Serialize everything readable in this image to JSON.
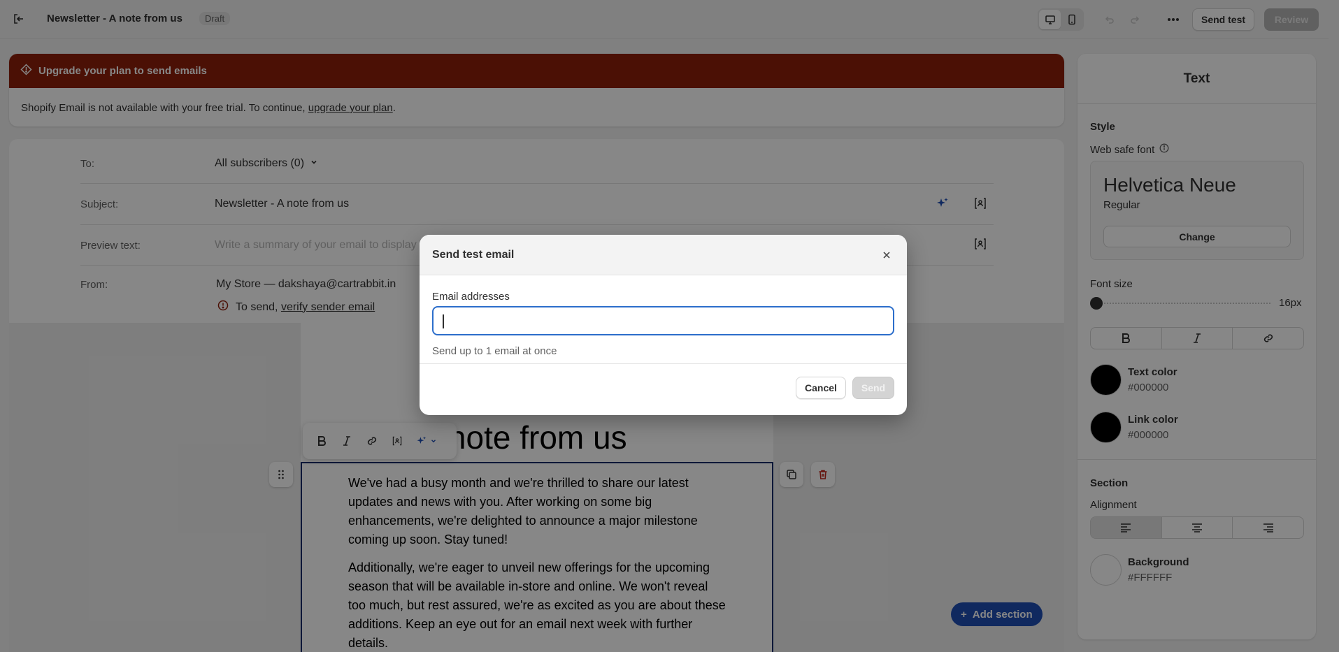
{
  "topbar": {
    "title": "Newsletter - A note from us",
    "status": "Draft",
    "send_test_label": "Send test",
    "review_label": "Review"
  },
  "banner": {
    "heading": "Upgrade your plan to send emails",
    "body_prefix": "Shopify Email is not available with your free trial. To continue, ",
    "link_text": "upgrade your plan",
    "body_suffix": "."
  },
  "fields": {
    "to_label": "To:",
    "to_value": "All subscribers (0)",
    "subject_label": "Subject:",
    "subject_value": "Newsletter - A note from us",
    "preview_label": "Preview text:",
    "preview_placeholder": "Write a summary of your email to display after the subject line",
    "from_label": "From:",
    "from_value": "My Store — dakshaya@cartrabbit.in",
    "verify_prefix": "To send, ",
    "verify_link": "verify sender email"
  },
  "email": {
    "heading": "A note from us",
    "paragraphs": [
      "We've had a busy month and we're thrilled to share our latest updates and news with you. After working on some big enhancements, we're delighted to announce a major milestone coming up soon. Stay tuned!",
      "Additionally, we're eager to unveil new offerings for the upcoming season that will be available in-store and online. We won't reveal too much, but rest assured, we're as excited as you are about these additions. Keep an eye out for an email next week with further details."
    ],
    "add_section_label": "Add section"
  },
  "panel": {
    "title": "Text",
    "style_heading": "Style",
    "font_label": "Web safe font",
    "font_name": "Helvetica Neue",
    "font_weight": "Regular",
    "change_label": "Change",
    "font_size_label": "Font size",
    "font_size_value": "16px",
    "font_size_level": 0.0,
    "text_color_label": "Text color",
    "text_color_value": "#000000",
    "link_color_label": "Link color",
    "link_color_value": "#000000",
    "section_heading": "Section",
    "alignment_label": "Alignment",
    "alignment_selected": "left",
    "background_label": "Background",
    "background_value": "#FFFFFF"
  },
  "modal": {
    "title": "Send test email",
    "field_label": "Email addresses",
    "input_value": "",
    "help_text": "Send up to 1 email at once",
    "cancel_label": "Cancel",
    "send_label": "Send"
  },
  "colors": {
    "banner_red": "#8e1f0b",
    "accent_blue": "#1f4fb4",
    "focus_blue": "#2c6ecb"
  }
}
